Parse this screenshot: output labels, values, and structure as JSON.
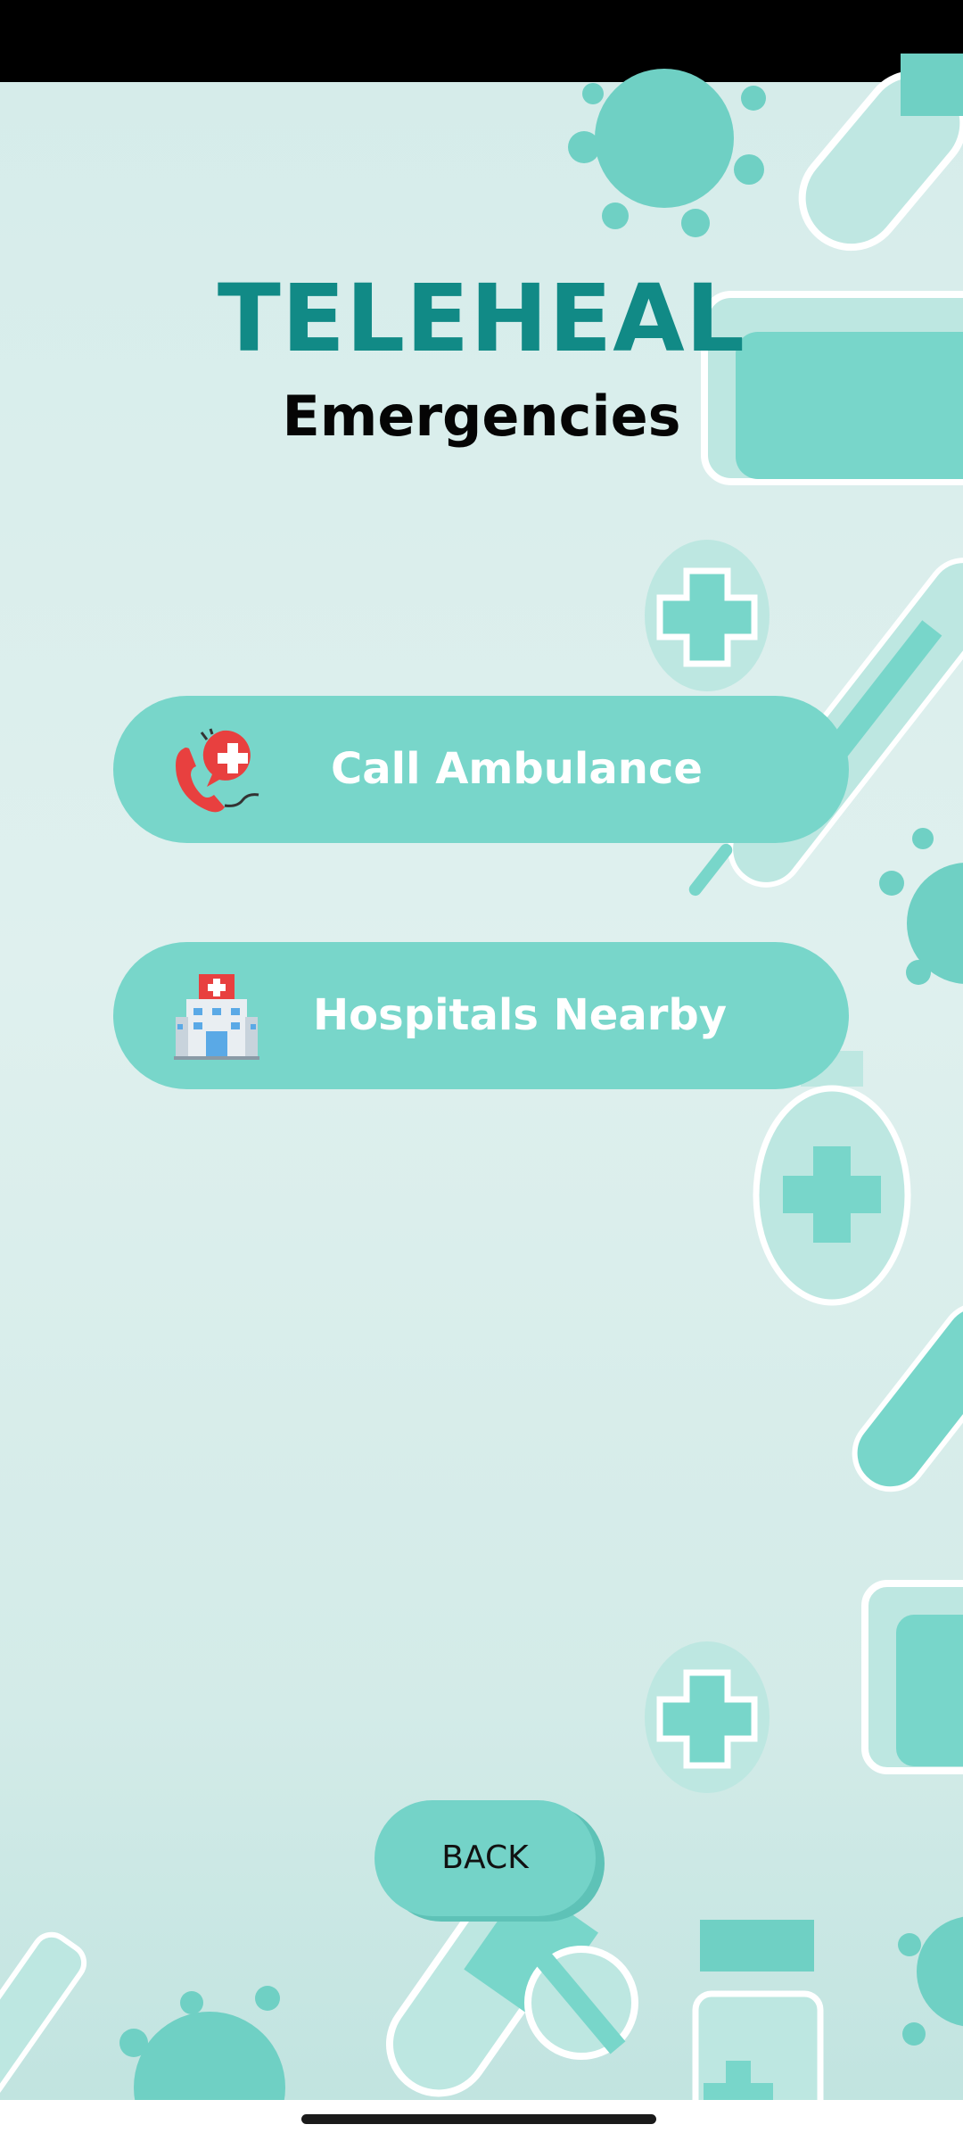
{
  "app": {
    "title": "TELEHEAL",
    "subtitle": "Emergencies"
  },
  "buttons": {
    "call_ambulance": {
      "label": "Call Ambulance",
      "icon": "ambulance-call-icon"
    },
    "hospitals_nearby": {
      "label": "Hospitals Nearby",
      "icon": "hospital-icon"
    },
    "back": {
      "label": "BACK"
    }
  },
  "theme": {
    "accent": "#118a86",
    "button": "#78d6ca",
    "background": "#d5ecea"
  }
}
